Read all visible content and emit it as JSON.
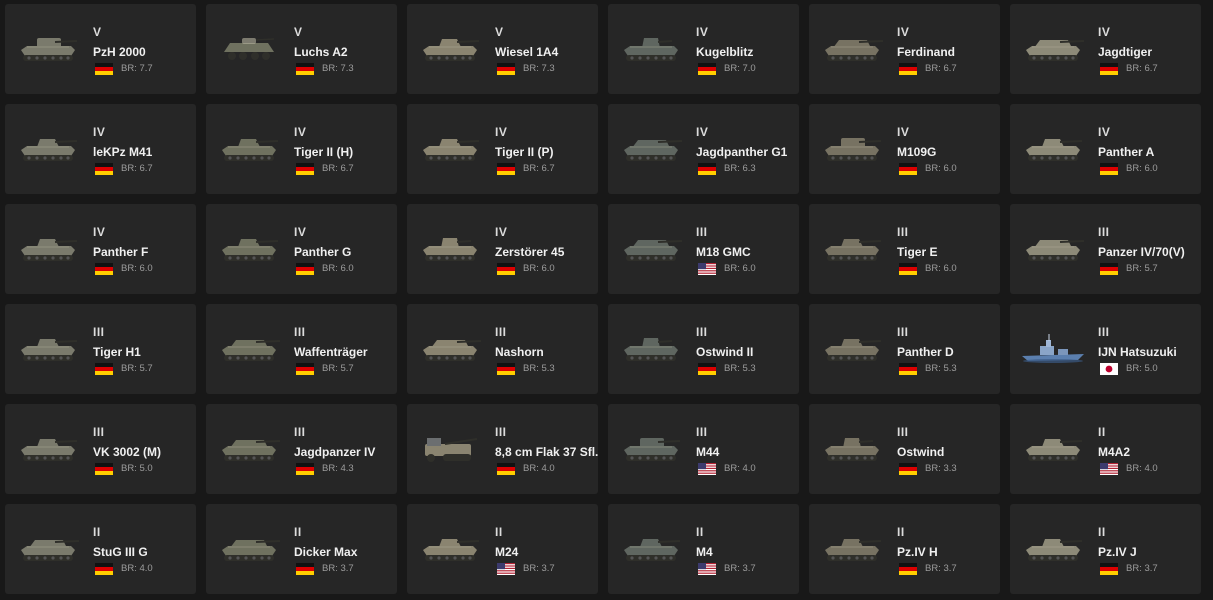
{
  "vehicles": [
    {
      "tier": "V",
      "name": "PzH 2000",
      "br": "BR: 7.7",
      "flag": "germany",
      "icon": "spg-vehicle-icon"
    },
    {
      "tier": "V",
      "name": "Luchs A2",
      "br": "BR: 7.3",
      "flag": "germany",
      "icon": "wheeled-vehicle-icon"
    },
    {
      "tier": "V",
      "name": "Wiesel 1A4",
      "br": "BR: 7.3",
      "flag": "germany",
      "icon": "light-tankette-icon"
    },
    {
      "tier": "IV",
      "name": "Kugelblitz",
      "br": "BR: 7.0",
      "flag": "germany",
      "icon": "spaa-vehicle-icon"
    },
    {
      "tier": "IV",
      "name": "Ferdinand",
      "br": "BR: 6.7",
      "flag": "germany",
      "icon": "tank-destroyer-icon"
    },
    {
      "tier": "IV",
      "name": "Jagdtiger",
      "br": "BR: 6.7",
      "flag": "germany",
      "icon": "tank-destroyer-icon"
    },
    {
      "tier": "IV",
      "name": "leKPz M41",
      "br": "BR: 6.7",
      "flag": "germany",
      "icon": "light-tank-icon"
    },
    {
      "tier": "IV",
      "name": "Tiger II (H)",
      "br": "BR: 6.7",
      "flag": "germany",
      "icon": "heavy-tank-icon"
    },
    {
      "tier": "IV",
      "name": "Tiger II (P)",
      "br": "BR: 6.7",
      "flag": "germany",
      "icon": "heavy-tank-icon"
    },
    {
      "tier": "IV",
      "name": "Jagdpanther G1",
      "br": "BR: 6.3",
      "flag": "germany",
      "icon": "tank-destroyer-icon"
    },
    {
      "tier": "IV",
      "name": "M109G",
      "br": "BR: 6.0",
      "flag": "germany",
      "icon": "spg-vehicle-icon"
    },
    {
      "tier": "IV",
      "name": "Panther A",
      "br": "BR: 6.0",
      "flag": "germany",
      "icon": "medium-tank-icon"
    },
    {
      "tier": "IV",
      "name": "Panther F",
      "br": "BR: 6.0",
      "flag": "germany",
      "icon": "medium-tank-icon"
    },
    {
      "tier": "IV",
      "name": "Panther G",
      "br": "BR: 6.0",
      "flag": "germany",
      "icon": "medium-tank-icon"
    },
    {
      "tier": "IV",
      "name": "Zerstörer 45",
      "br": "BR: 6.0",
      "flag": "germany",
      "icon": "spaa-vehicle-icon"
    },
    {
      "tier": "III",
      "name": "M18 GMC",
      "br": "BR: 6.0",
      "flag": "usa",
      "icon": "tank-destroyer-icon"
    },
    {
      "tier": "III",
      "name": "Tiger E",
      "br": "BR: 6.0",
      "flag": "germany",
      "icon": "heavy-tank-icon"
    },
    {
      "tier": "III",
      "name": "Panzer IV/70(V)",
      "br": "BR: 5.7",
      "flag": "germany",
      "icon": "tank-destroyer-icon"
    },
    {
      "tier": "III",
      "name": "Tiger H1",
      "br": "BR: 5.7",
      "flag": "germany",
      "icon": "heavy-tank-icon"
    },
    {
      "tier": "III",
      "name": "Waffenträger",
      "br": "BR: 5.7",
      "flag": "germany",
      "icon": "tank-destroyer-icon"
    },
    {
      "tier": "III",
      "name": "Nashorn",
      "br": "BR: 5.3",
      "flag": "germany",
      "icon": "tank-destroyer-icon"
    },
    {
      "tier": "III",
      "name": "Ostwind II",
      "br": "BR: 5.3",
      "flag": "germany",
      "icon": "spaa-vehicle-icon"
    },
    {
      "tier": "III",
      "name": "Panther D",
      "br": "BR: 5.3",
      "flag": "germany",
      "icon": "medium-tank-icon"
    },
    {
      "tier": "III",
      "name": "IJN Hatsuzuki",
      "br": "BR: 5.0",
      "flag": "japan",
      "icon": "destroyer-ship-icon"
    },
    {
      "tier": "III",
      "name": "VK 3002 (M)",
      "br": "BR: 5.0",
      "flag": "germany",
      "icon": "medium-tank-icon"
    },
    {
      "tier": "III",
      "name": "Jagdpanzer IV",
      "br": "BR: 4.3",
      "flag": "germany",
      "icon": "tank-destroyer-icon"
    },
    {
      "tier": "III",
      "name": "8,8 cm Flak 37 Sfl.",
      "br": "BR: 4.0",
      "flag": "germany",
      "icon": "halftrack-icon"
    },
    {
      "tier": "III",
      "name": "M44",
      "br": "BR: 4.0",
      "flag": "usa",
      "icon": "spg-vehicle-icon"
    },
    {
      "tier": "III",
      "name": "Ostwind",
      "br": "BR: 3.3",
      "flag": "germany",
      "icon": "spaa-vehicle-icon"
    },
    {
      "tier": "II",
      "name": "M4A2",
      "br": "BR: 4.0",
      "flag": "usa",
      "icon": "medium-tank-icon"
    },
    {
      "tier": "II",
      "name": "StuG III G",
      "br": "BR: 4.0",
      "flag": "germany",
      "icon": "tank-destroyer-icon"
    },
    {
      "tier": "II",
      "name": "Dicker Max",
      "br": "BR: 3.7",
      "flag": "germany",
      "icon": "tank-destroyer-icon"
    },
    {
      "tier": "II",
      "name": "M24",
      "br": "BR: 3.7",
      "flag": "usa",
      "icon": "light-tank-icon"
    },
    {
      "tier": "II",
      "name": "M4",
      "br": "BR: 3.7",
      "flag": "usa",
      "icon": "medium-tank-icon"
    },
    {
      "tier": "II",
      "name": "Pz.IV H",
      "br": "BR: 3.7",
      "flag": "germany",
      "icon": "medium-tank-icon"
    },
    {
      "tier": "II",
      "name": "Pz.IV J",
      "br": "BR: 3.7",
      "flag": "germany",
      "icon": "medium-tank-icon"
    }
  ],
  "colors": {
    "page_background": "#181818",
    "card_background": "#262626",
    "name_text": "#f0f0f0",
    "br_text": "#9c9c9c",
    "ship_hull": "#5b7fae"
  }
}
